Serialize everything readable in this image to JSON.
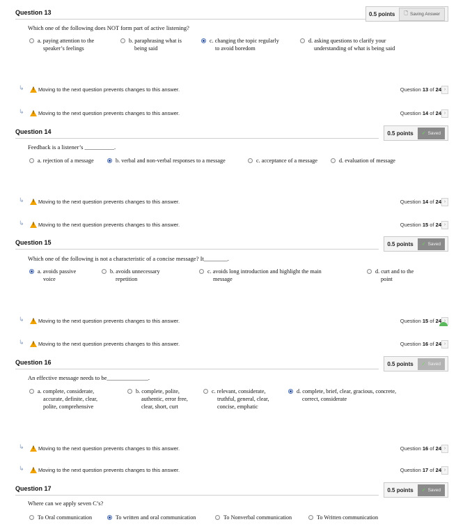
{
  "nav_message": "Moving to the next question prevents changes to this answer.",
  "nav_next": "›",
  "status_icons": {
    "saving": "🗋",
    "saved": "✓"
  },
  "questions": [
    {
      "title": "Question 13",
      "points": "0.5 points",
      "status": "Saving Answer",
      "text": "Which one of the following does NOT form part of active listening?",
      "options": [
        {
          "l1": "a. paying attention to the",
          "l2": "speaker’s feelings"
        },
        {
          "l1": "b. paraphrasing what is",
          "l2": "being said"
        },
        {
          "l1": "c. changing the topic regularly",
          "l2": "to avoid boredom"
        },
        {
          "l1": "d. asking questions to clarify your",
          "l2": "understanding of what is being said"
        }
      ]
    },
    {
      "title": "Question 14",
      "points": "0.5 points",
      "status": "Saved",
      "text": "Feedback is a listener’s __________.",
      "options": [
        {
          "l1": "a. rejection of a message"
        },
        {
          "l1": "b. verbal and non-verbal responses to a message"
        },
        {
          "l1": "c. acceptance of a message"
        },
        {
          "l1": "d. evaluation of message"
        }
      ]
    },
    {
      "title": "Question 15",
      "points": "0.5 points",
      "status": "Saved",
      "text": "Which one of the following is not a characteristic of a concise message? It________.",
      "options": [
        {
          "l1": "a. avoids passive",
          "l2": "voice"
        },
        {
          "l1": "b. avoids unnecessary",
          "l2": "repetition"
        },
        {
          "l1": "c. avoids long introduction and highlight the main",
          "l2": "message"
        },
        {
          "l1": "d. curt and to the",
          "l2": "point"
        }
      ]
    },
    {
      "title": "Question 16",
      "points": "0.5 points",
      "status": "Saved",
      "text": "An effective message needs to be______________.",
      "options": [
        {
          "l1": "a. complete, considerate,",
          "l2": "accurate, definite, clear,",
          "l3": "polite, comprehensive"
        },
        {
          "l1": "b. complete, polite,",
          "l2": "authentic, error free,",
          "l3": "clear, short, curt"
        },
        {
          "l1": "c. relevant, considerate,",
          "l2": "truthful, general, clear,",
          "l3": "concise, emphatic"
        },
        {
          "l1": "d. complete, brief, clear, gracious, concrete,",
          "l2": "correct, considerate"
        }
      ]
    },
    {
      "title": "Question 17",
      "points": "0.5 points",
      "status": "Saved",
      "text": "Where can we apply seven C’s?",
      "options": [
        {
          "l1": "To Oral communication"
        },
        {
          "l1": "To written and oral communication"
        },
        {
          "l1": "To Nonverbal communication"
        },
        {
          "l1": "To Written communication"
        }
      ]
    }
  ],
  "navs": [
    {
      "num": "13",
      "total": "24",
      "of": "of"
    },
    {
      "num": "14",
      "total": "24",
      "of": "of"
    },
    {
      "num": "14",
      "total": "24",
      "of": "of"
    },
    {
      "num": "15",
      "total": "24",
      "of": "of"
    },
    {
      "num": "15",
      "total": "24",
      "of": "of"
    },
    {
      "num": "16",
      "total": "24",
      "of": "of"
    },
    {
      "num": "16",
      "total": "24",
      "of": "of"
    },
    {
      "num": "17",
      "total": "24",
      "of": "of"
    }
  ],
  "nav_label": "Question"
}
